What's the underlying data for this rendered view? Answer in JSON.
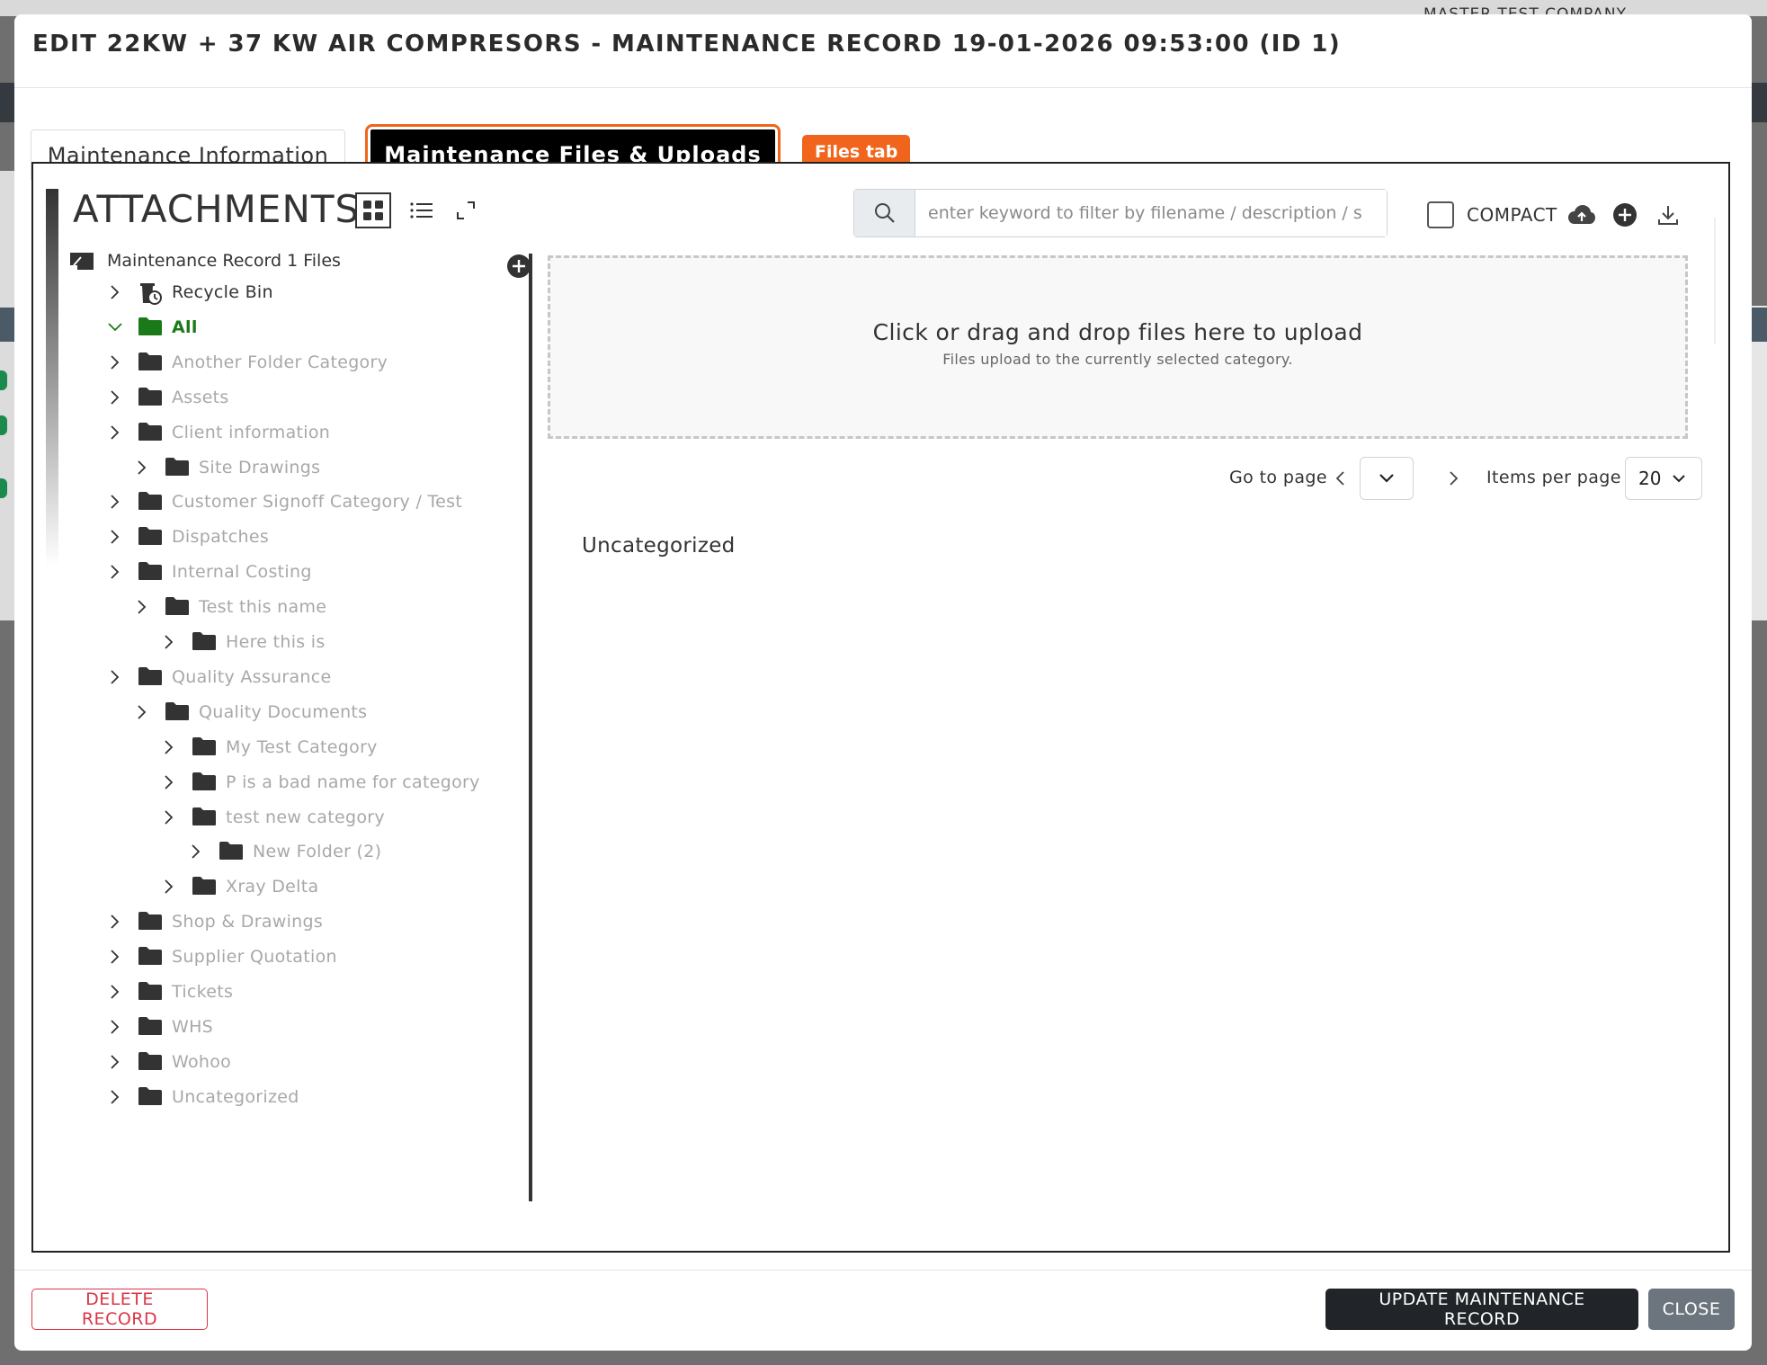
{
  "background": {
    "company": "MASTER TEST COMPANY"
  },
  "modal": {
    "title": "EDIT 22KW + 37 KW AIR COMPRESORS - MAINTENANCE RECORD 19-01-2026 09:53:00 (ID 1)",
    "tabs": [
      {
        "label": "Maintenance Information",
        "active": false
      },
      {
        "label": "Maintenance Files & Uploads",
        "active": true
      }
    ],
    "files_tab_badge": "Files tab",
    "attachments": {
      "title": "ATTACHMENTS",
      "search_placeholder": "enter keyword to filter by filename / description / s",
      "compact_label": "COMPACT",
      "compact_checked": false
    },
    "tree": {
      "root_label": "Maintenance Record 1 Files",
      "nodes": [
        {
          "label": "Recycle Bin",
          "depth": 1,
          "type": "recycle"
        },
        {
          "label": "All",
          "depth": 1,
          "type": "all",
          "expanded": true
        },
        {
          "label": "Another Folder Category",
          "depth": 1
        },
        {
          "label": "Assets",
          "depth": 1
        },
        {
          "label": "Client information",
          "depth": 1
        },
        {
          "label": "Site Drawings",
          "depth": 2
        },
        {
          "label": "Customer Signoff Category / Test",
          "depth": 1
        },
        {
          "label": "Dispatches",
          "depth": 1
        },
        {
          "label": "Internal Costing",
          "depth": 1
        },
        {
          "label": "Test this name",
          "depth": 2
        },
        {
          "label": "Here this is",
          "depth": 3
        },
        {
          "label": "Quality Assurance",
          "depth": 1
        },
        {
          "label": "Quality Documents",
          "depth": 2
        },
        {
          "label": "My Test Category",
          "depth": 3
        },
        {
          "label": "P is a bad name for category",
          "depth": 3
        },
        {
          "label": "test new category",
          "depth": 3
        },
        {
          "label": "New Folder (2)",
          "depth": 4
        },
        {
          "label": "Xray Delta",
          "depth": 3
        },
        {
          "label": "Shop & Drawings",
          "depth": 1
        },
        {
          "label": "Supplier Quotation",
          "depth": 1
        },
        {
          "label": "Tickets",
          "depth": 1
        },
        {
          "label": "WHS",
          "depth": 1
        },
        {
          "label": "Wohoo",
          "depth": 1
        },
        {
          "label": "Uncategorized",
          "depth": 1
        }
      ]
    },
    "dropzone": {
      "main": "Click or drag and drop files here to upload",
      "sub": "Files upload to the currently selected category."
    },
    "pager": {
      "go_to_page": "Go to page",
      "items_per_page_label": "Items per page",
      "items_per_page": "20"
    },
    "section_heading": "Uncategorized",
    "footer": {
      "delete_label": "DELETE RECORD",
      "update_label": "UPDATE MAINTENANCE RECORD",
      "close_label": "CLOSE"
    }
  },
  "colors": {
    "accent": "#f0651b",
    "all_folder": "#1a7a1a",
    "danger": "#dc3545",
    "dark_button": "#212529",
    "secondary_button": "#6c757d"
  }
}
